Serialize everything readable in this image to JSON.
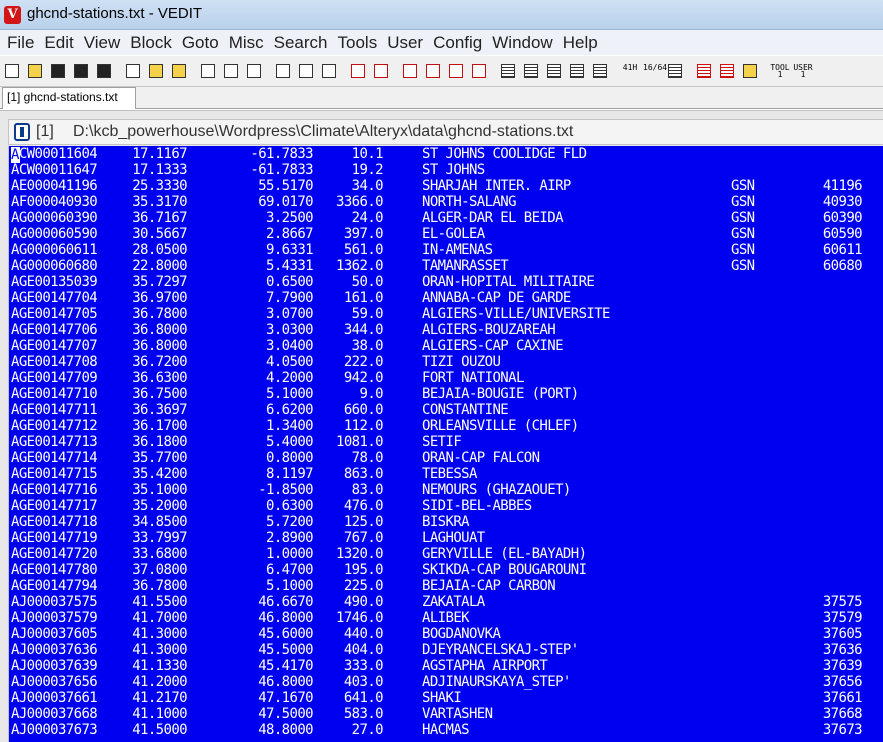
{
  "window": {
    "title": "ghcnd-stations.txt - VEDIT",
    "app_icon": "vedit-logo-icon",
    "accent": "#0000f0"
  },
  "menu": [
    "File",
    "Edit",
    "View",
    "Block",
    "Goto",
    "Misc",
    "Search",
    "Tools",
    "User",
    "Config",
    "Window",
    "Help"
  ],
  "toolbar": {
    "buttons": [
      "new-file-icon",
      "open-file-icon",
      "save-icon",
      "save-all-icon",
      "print-icon",
      "window-list-icon",
      "goto-line-icon",
      "goto-mark-icon",
      "cut-icon",
      "copy-icon",
      "paste-icon",
      "cut-append-icon",
      "copy-append-icon",
      "paste-buffer-icon",
      "undo-icon",
      "redo-icon",
      "find-icon",
      "find-replace-icon",
      "find-next-icon",
      "find-previous-icon",
      "indent-icon",
      "unindent-icon",
      "format-paragraph-icon",
      "justify-icon",
      "ruler-icon",
      "hex-icon",
      "column-icon",
      "compare-icon",
      "split-icon",
      "wrap-icon",
      "hilite-icon",
      "tool-1-icon",
      "user-1-icon"
    ],
    "hex_label": "41H",
    "ratio_label": "16/64",
    "tool_label": "TOOL",
    "tool_num": "1",
    "user_label": "USER",
    "user_num": "1"
  },
  "tab": {
    "label": "[1] ghcnd-stations.txt"
  },
  "document": {
    "number": "[1]",
    "path": "D:\\kcb_powerhouse\\Wordpress\\Climate\\Alteryx\\data\\ghcnd-stations.txt",
    "cursor_char": "A",
    "rows": [
      {
        "id": "ACW00011604",
        "lat": "17.1167",
        "lon": "-61.7833",
        "el": "10.1",
        "name": "ST JOHNS COOLIDGE FLD",
        "gsn": "",
        "wmo": ""
      },
      {
        "id": "ACW00011647",
        "lat": "17.1333",
        "lon": "-61.7833",
        "el": "19.2",
        "name": "ST JOHNS",
        "gsn": "",
        "wmo": ""
      },
      {
        "id": "AE000041196",
        "lat": "25.3330",
        "lon": "55.5170",
        "el": "34.0",
        "name": "SHARJAH INTER. AIRP",
        "gsn": "GSN",
        "wmo": "41196"
      },
      {
        "id": "AF000040930",
        "lat": "35.3170",
        "lon": "69.0170",
        "el": "3366.0",
        "name": "NORTH-SALANG",
        "gsn": "GSN",
        "wmo": "40930"
      },
      {
        "id": "AG000060390",
        "lat": "36.7167",
        "lon": "3.2500",
        "el": "24.0",
        "name": "ALGER-DAR EL BEIDA",
        "gsn": "GSN",
        "wmo": "60390"
      },
      {
        "id": "AG000060590",
        "lat": "30.5667",
        "lon": "2.8667",
        "el": "397.0",
        "name": "EL-GOLEA",
        "gsn": "GSN",
        "wmo": "60590"
      },
      {
        "id": "AG000060611",
        "lat": "28.0500",
        "lon": "9.6331",
        "el": "561.0",
        "name": "IN-AMENAS",
        "gsn": "GSN",
        "wmo": "60611"
      },
      {
        "id": "AG000060680",
        "lat": "22.8000",
        "lon": "5.4331",
        "el": "1362.0",
        "name": "TAMANRASSET",
        "gsn": "GSN",
        "wmo": "60680"
      },
      {
        "id": "AGE00135039",
        "lat": "35.7297",
        "lon": "0.6500",
        "el": "50.0",
        "name": "ORAN-HOPITAL MILITAIRE",
        "gsn": "",
        "wmo": ""
      },
      {
        "id": "AGE00147704",
        "lat": "36.9700",
        "lon": "7.7900",
        "el": "161.0",
        "name": "ANNABA-CAP DE GARDE",
        "gsn": "",
        "wmo": ""
      },
      {
        "id": "AGE00147705",
        "lat": "36.7800",
        "lon": "3.0700",
        "el": "59.0",
        "name": "ALGIERS-VILLE/UNIVERSITE",
        "gsn": "",
        "wmo": ""
      },
      {
        "id": "AGE00147706",
        "lat": "36.8000",
        "lon": "3.0300",
        "el": "344.0",
        "name": "ALGIERS-BOUZAREAH",
        "gsn": "",
        "wmo": ""
      },
      {
        "id": "AGE00147707",
        "lat": "36.8000",
        "lon": "3.0400",
        "el": "38.0",
        "name": "ALGIERS-CAP CAXINE",
        "gsn": "",
        "wmo": ""
      },
      {
        "id": "AGE00147708",
        "lat": "36.7200",
        "lon": "4.0500",
        "el": "222.0",
        "name": "TIZI OUZOU",
        "gsn": "",
        "wmo": ""
      },
      {
        "id": "AGE00147709",
        "lat": "36.6300",
        "lon": "4.2000",
        "el": "942.0",
        "name": "FORT NATIONAL",
        "gsn": "",
        "wmo": ""
      },
      {
        "id": "AGE00147710",
        "lat": "36.7500",
        "lon": "5.1000",
        "el": "9.0",
        "name": "BEJAIA-BOUGIE (PORT)",
        "gsn": "",
        "wmo": ""
      },
      {
        "id": "AGE00147711",
        "lat": "36.3697",
        "lon": "6.6200",
        "el": "660.0",
        "name": "CONSTANTINE",
        "gsn": "",
        "wmo": ""
      },
      {
        "id": "AGE00147712",
        "lat": "36.1700",
        "lon": "1.3400",
        "el": "112.0",
        "name": "ORLEANSVILLE (CHLEF)",
        "gsn": "",
        "wmo": ""
      },
      {
        "id": "AGE00147713",
        "lat": "36.1800",
        "lon": "5.4000",
        "el": "1081.0",
        "name": "SETIF",
        "gsn": "",
        "wmo": ""
      },
      {
        "id": "AGE00147714",
        "lat": "35.7700",
        "lon": "0.8000",
        "el": "78.0",
        "name": "ORAN-CAP FALCON",
        "gsn": "",
        "wmo": ""
      },
      {
        "id": "AGE00147715",
        "lat": "35.4200",
        "lon": "8.1197",
        "el": "863.0",
        "name": "TEBESSA",
        "gsn": "",
        "wmo": ""
      },
      {
        "id": "AGE00147716",
        "lat": "35.1000",
        "lon": "-1.8500",
        "el": "83.0",
        "name": "NEMOURS (GHAZAOUET)",
        "gsn": "",
        "wmo": ""
      },
      {
        "id": "AGE00147717",
        "lat": "35.2000",
        "lon": "0.6300",
        "el": "476.0",
        "name": "SIDI-BEL-ABBES",
        "gsn": "",
        "wmo": ""
      },
      {
        "id": "AGE00147718",
        "lat": "34.8500",
        "lon": "5.7200",
        "el": "125.0",
        "name": "BISKRA",
        "gsn": "",
        "wmo": ""
      },
      {
        "id": "AGE00147719",
        "lat": "33.7997",
        "lon": "2.8900",
        "el": "767.0",
        "name": "LAGHOUAT",
        "gsn": "",
        "wmo": ""
      },
      {
        "id": "AGE00147720",
        "lat": "33.6800",
        "lon": "1.0000",
        "el": "1320.0",
        "name": "GERYVILLE (EL-BAYADH)",
        "gsn": "",
        "wmo": ""
      },
      {
        "id": "AGE00147780",
        "lat": "37.0800",
        "lon": "6.4700",
        "el": "195.0",
        "name": "SKIKDA-CAP BOUGAROUNI",
        "gsn": "",
        "wmo": ""
      },
      {
        "id": "AGE00147794",
        "lat": "36.7800",
        "lon": "5.1000",
        "el": "225.0",
        "name": "BEJAIA-CAP CARBON",
        "gsn": "",
        "wmo": ""
      },
      {
        "id": "AJ000037575",
        "lat": "41.5500",
        "lon": "46.6670",
        "el": "490.0",
        "name": "ZAKATALA",
        "gsn": "",
        "wmo": "37575"
      },
      {
        "id": "AJ000037579",
        "lat": "41.7000",
        "lon": "46.8000",
        "el": "1746.0",
        "name": "ALIBEK",
        "gsn": "",
        "wmo": "37579"
      },
      {
        "id": "AJ000037605",
        "lat": "41.3000",
        "lon": "45.6000",
        "el": "440.0",
        "name": "BOGDANOVKA",
        "gsn": "",
        "wmo": "37605"
      },
      {
        "id": "AJ000037636",
        "lat": "41.3000",
        "lon": "45.5000",
        "el": "404.0",
        "name": "DJEYRANCELSKAJ-STEP'",
        "gsn": "",
        "wmo": "37636"
      },
      {
        "id": "AJ000037639",
        "lat": "41.1330",
        "lon": "45.4170",
        "el": "333.0",
        "name": "AGSTAPHA AIRPORT",
        "gsn": "",
        "wmo": "37639"
      },
      {
        "id": "AJ000037656",
        "lat": "41.2000",
        "lon": "46.8000",
        "el": "403.0",
        "name": "ADJINAURSKAYA_STEP'",
        "gsn": "",
        "wmo": "37656"
      },
      {
        "id": "AJ000037661",
        "lat": "41.2170",
        "lon": "47.1670",
        "el": "641.0",
        "name": "SHAKI",
        "gsn": "",
        "wmo": "37661"
      },
      {
        "id": "AJ000037668",
        "lat": "41.1000",
        "lon": "47.5000",
        "el": "583.0",
        "name": "VARTASHEN",
        "gsn": "",
        "wmo": "37668"
      },
      {
        "id": "AJ000037673",
        "lat": "41.5000",
        "lon": "48.8000",
        "el": "27.0",
        "name": "HACMAS",
        "gsn": "",
        "wmo": "37673"
      }
    ]
  }
}
